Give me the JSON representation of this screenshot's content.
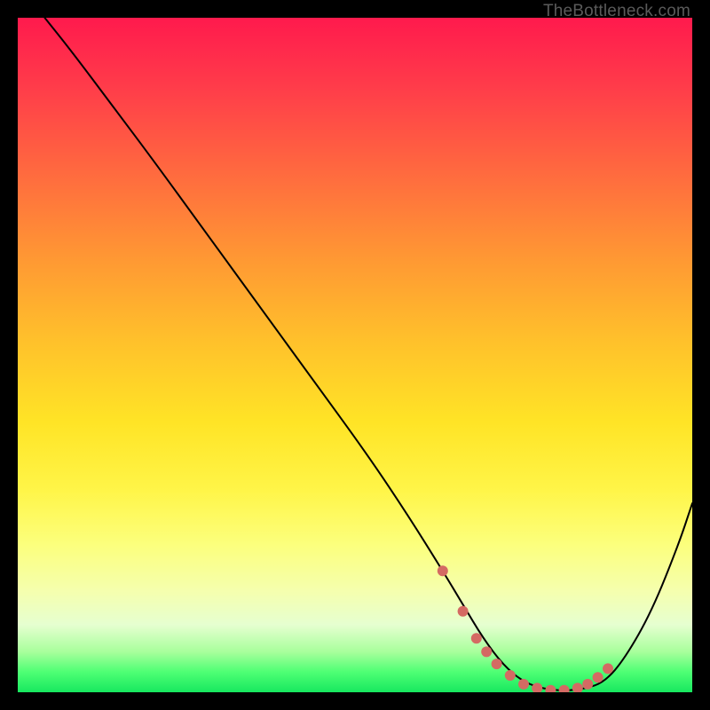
{
  "watermark": "TheBottleneck.com",
  "chart_data": {
    "type": "line",
    "title": "",
    "xlabel": "",
    "ylabel": "",
    "xlim": [
      0,
      100
    ],
    "ylim": [
      0,
      100
    ],
    "grid": false,
    "legend": false,
    "series": [
      {
        "name": "bottleneck-curve",
        "x": [
          4,
          8,
          14,
          20,
          28,
          36,
          44,
          52,
          58,
          63,
          66,
          69,
          72,
          75,
          78,
          81,
          84,
          87,
          90,
          94,
          98,
          100
        ],
        "y": [
          100,
          95,
          87,
          79,
          68,
          57,
          46,
          35,
          26,
          18,
          13,
          8,
          4,
          1.5,
          0.5,
          0.2,
          0.5,
          1.5,
          5,
          12,
          22,
          28
        ]
      }
    ],
    "highlight_points": {
      "name": "dots",
      "x": [
        63,
        66,
        68,
        69.5,
        71,
        73,
        75,
        77,
        79,
        81,
        83,
        84.5,
        86,
        87.5
      ],
      "y": [
        18,
        12,
        8,
        6,
        4.2,
        2.5,
        1.2,
        0.6,
        0.3,
        0.3,
        0.6,
        1.2,
        2.2,
        3.5
      ]
    },
    "background": {
      "type": "vertical-gradient",
      "stops": [
        {
          "pos": 0,
          "color": "#ff1a4d"
        },
        {
          "pos": 50,
          "color": "#ffc12b"
        },
        {
          "pos": 80,
          "color": "#fcff7c"
        },
        {
          "pos": 100,
          "color": "#17e85f"
        }
      ]
    }
  }
}
